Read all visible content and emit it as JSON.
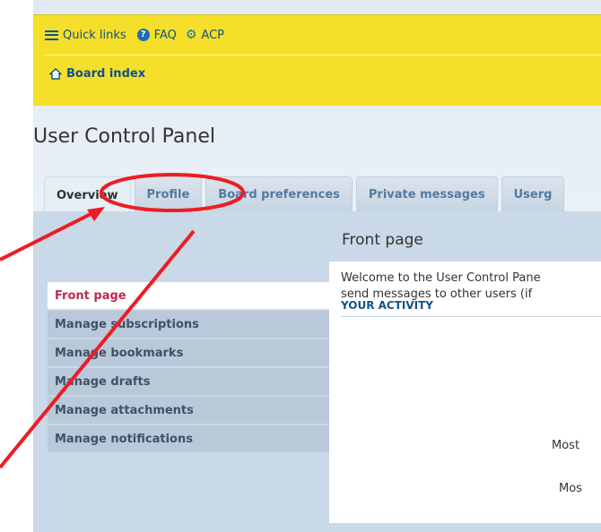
{
  "navbar": {
    "quick_links": "Quick links",
    "faq": "FAQ",
    "acp": "ACP",
    "board_index": "Board index"
  },
  "page_title": "User Control Panel",
  "tabs": [
    {
      "label": "Overview",
      "active": true
    },
    {
      "label": "Profile"
    },
    {
      "label": "Board preferences"
    },
    {
      "label": "Private messages"
    },
    {
      "label": "Userg"
    }
  ],
  "menu": [
    {
      "label": "Front page",
      "active": true
    },
    {
      "label": "Manage subscriptions"
    },
    {
      "label": "Manage bookmarks"
    },
    {
      "label": "Manage drafts"
    },
    {
      "label": "Manage attachments"
    },
    {
      "label": "Manage notifications"
    }
  ],
  "main": {
    "section_title": "Front page",
    "welcome_line1": "Welcome to the User Control Pane",
    "welcome_line2": "send messages to other users (if",
    "activity_heading": "YOUR ACTIVITY",
    "stat1": "Most",
    "stat2": "Mos"
  },
  "colors": {
    "navbar": "#f6df2a",
    "link": "#105289",
    "active_menu_text": "#bc2a4d",
    "annotation": "#ee1c24"
  }
}
